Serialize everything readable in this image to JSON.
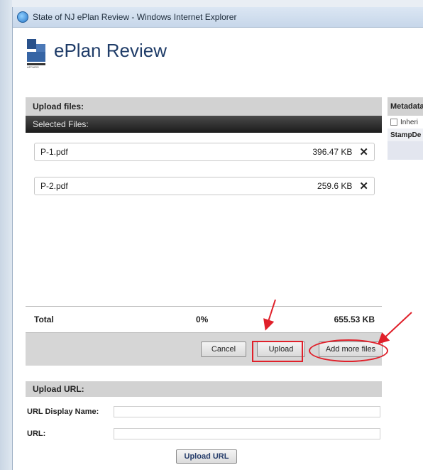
{
  "window": {
    "title": "State of NJ ePlan Review - Windows Internet Explorer"
  },
  "app": {
    "brand": "ePlan Review",
    "logo_caption": "AFFAIRS"
  },
  "upload": {
    "heading": "Upload files:",
    "selected_label": "Selected Files:",
    "files": [
      {
        "name": "P-1.pdf",
        "size": "396.47 KB"
      },
      {
        "name": "P-2.pdf",
        "size": "259.6 KB"
      }
    ],
    "total": {
      "label": "Total",
      "percent": "0%",
      "size": "655.53 KB"
    },
    "buttons": {
      "cancel": "Cancel",
      "upload": "Upload",
      "add_more": "Add more files"
    }
  },
  "metadata": {
    "heading": "Metadata",
    "inherit_label": "Inheri",
    "stamp_label": "StampDe"
  },
  "url_section": {
    "heading": "Upload URL:",
    "display_name_label": "URL Display Name:",
    "display_name_value": "",
    "url_label": "URL:",
    "url_value": "",
    "button": "Upload URL"
  },
  "annotations": {
    "highlight_color": "#e0202a"
  },
  "icons": {
    "browser": "ie-icon",
    "remove": "close-icon"
  }
}
